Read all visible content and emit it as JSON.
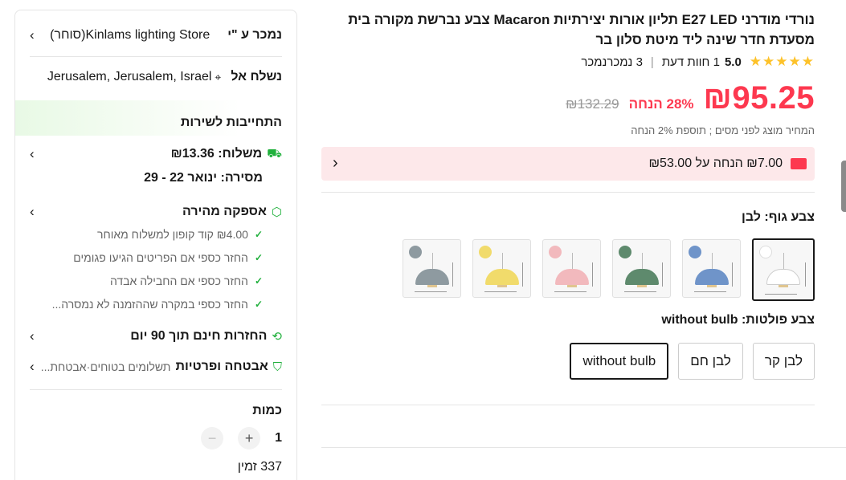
{
  "product": {
    "title": "נורדי מודרני E27 LED תליון אורות יצירתיות Macaron צבע נברשת מקורה בית מסעדת חדר שינה ליד מיטת סלון בר",
    "stars": "★★★★★",
    "score": "5.0",
    "reviews": "1 חוות דעת",
    "sold": "3 נמכרנמכר",
    "price": "₪95.25",
    "discount": "28% הנחה",
    "original_price": "₪132.29",
    "tax_note": "המחיר מוצג לפני מסים ; תוספת 2% הנחה",
    "coupon_text": "₪7.00 הנחה על ₪53.00",
    "coupon_icon": "%",
    "color_label": "צבע גוף: לבן",
    "colors": [
      {
        "name": "white",
        "dot": "#ffffff",
        "shade": "#ffffff"
      },
      {
        "name": "blue",
        "dot": "#6f94c9",
        "shade": "#6f94c9"
      },
      {
        "name": "green",
        "dot": "#5e8a6d",
        "shade": "#5e8a6d"
      },
      {
        "name": "pink",
        "dot": "#f2b9bd",
        "shade": "#f2b9bd"
      },
      {
        "name": "yellow",
        "dot": "#f1db6b",
        "shade": "#f1db6b"
      },
      {
        "name": "grey",
        "dot": "#8e9aa0",
        "shade": "#8e9aa0"
      }
    ],
    "bulb_label": "צבע פולטות: without bulb",
    "bulb_options": [
      "לבן קר",
      "לבן חם",
      "without bulb"
    ]
  },
  "panel": {
    "seller_label": "נמכר ע \"י",
    "seller_name": "Kinlams lighting Store(סוחר)",
    "ship_to_label": "נשלח אל",
    "ship_to_value": "Jerusalem, Jerusalem, Israel",
    "commitment": "התחייבות לשירות",
    "shipping": "משלוח: ₪13.36",
    "delivery": "מסירה: ינואר 22 - 29",
    "fast_delivery": "אספקה מהירה",
    "guarantees": [
      "₪4.00 קוד קופון למשלוח מאוחר",
      "החזר כספי אם הפריטים הגיעו פגומים",
      "החזר כספי אם החבילה אבדה",
      "החזר כספי במקרה שההזמנה לא נמסרה..."
    ],
    "returns": "החזרות חינם תוך 90 יום",
    "security_bold": "אבטחה ופרטיות",
    "security_rest": "תשלומים בטוחים·אבטחת...",
    "qty_label": "כמות",
    "qty_value": "1",
    "stock": "337 זמין"
  },
  "icons": {
    "chevron": "‹",
    "chevron_right": "›",
    "pin": "⌖",
    "truck": "⛟",
    "box": "⬡",
    "check": "✓",
    "return": "⟲",
    "shield": "⛉"
  }
}
